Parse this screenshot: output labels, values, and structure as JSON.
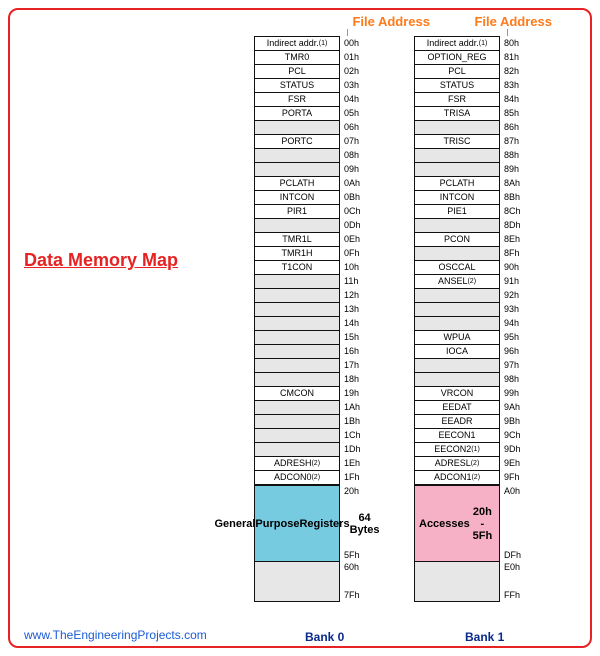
{
  "title": "Data Memory Map",
  "url": "www.TheEngineeringProjects.com",
  "headers": {
    "fileAddress": "File Address"
  },
  "bankLabels": {
    "bank0": "Bank 0",
    "bank1": "Bank 1"
  },
  "bank0": {
    "rows": [
      {
        "name": "Indirect addr.",
        "sup": "(1)",
        "addr": "00h"
      },
      {
        "name": "TMR0",
        "addr": "01h"
      },
      {
        "name": "PCL",
        "addr": "02h"
      },
      {
        "name": "STATUS",
        "addr": "03h"
      },
      {
        "name": "FSR",
        "addr": "04h"
      },
      {
        "name": "PORTA",
        "addr": "05h"
      },
      {
        "name": "",
        "reserved": true,
        "addr": "06h"
      },
      {
        "name": "PORTC",
        "addr": "07h"
      },
      {
        "name": "",
        "reserved": true,
        "addr": "08h"
      },
      {
        "name": "",
        "reserved": true,
        "addr": "09h"
      },
      {
        "name": "PCLATH",
        "addr": "0Ah"
      },
      {
        "name": "INTCON",
        "addr": "0Bh"
      },
      {
        "name": "PIR1",
        "addr": "0Ch"
      },
      {
        "name": "",
        "reserved": true,
        "addr": "0Dh"
      },
      {
        "name": "TMR1L",
        "addr": "0Eh"
      },
      {
        "name": "TMR1H",
        "addr": "0Fh"
      },
      {
        "name": "T1CON",
        "addr": "10h"
      },
      {
        "name": "",
        "reserved": true,
        "addr": "11h"
      },
      {
        "name": "",
        "reserved": true,
        "addr": "12h"
      },
      {
        "name": "",
        "reserved": true,
        "addr": "13h"
      },
      {
        "name": "",
        "reserved": true,
        "addr": "14h"
      },
      {
        "name": "",
        "reserved": true,
        "addr": "15h"
      },
      {
        "name": "",
        "reserved": true,
        "addr": "16h"
      },
      {
        "name": "",
        "reserved": true,
        "addr": "17h"
      },
      {
        "name": "",
        "reserved": true,
        "addr": "18h"
      },
      {
        "name": "CMCON",
        "addr": "19h"
      },
      {
        "name": "",
        "reserved": true,
        "addr": "1Ah"
      },
      {
        "name": "",
        "reserved": true,
        "addr": "1Bh"
      },
      {
        "name": "",
        "reserved": true,
        "addr": "1Ch"
      },
      {
        "name": "",
        "reserved": true,
        "addr": "1Dh"
      },
      {
        "name": "ADRESH",
        "sup": "(2)",
        "addr": "1Eh"
      },
      {
        "name": "ADCON0",
        "sup": "(2)",
        "addr": "1Fh"
      }
    ],
    "gpBlock": {
      "line1": "General",
      "line2": "Purpose",
      "line3": "Registers",
      "line4": "64 Bytes",
      "addrTop": "20h",
      "addrBottom": "5Fh"
    },
    "greyBlock": {
      "addrTop": "60h",
      "addrBottom": "7Fh"
    }
  },
  "bank1": {
    "rows": [
      {
        "name": "Indirect addr.",
        "sup": "(1)",
        "addr": "80h"
      },
      {
        "name": "OPTION_REG",
        "addr": "81h"
      },
      {
        "name": "PCL",
        "addr": "82h"
      },
      {
        "name": "STATUS",
        "addr": "83h"
      },
      {
        "name": "FSR",
        "addr": "84h"
      },
      {
        "name": "TRISA",
        "addr": "85h"
      },
      {
        "name": "",
        "reserved": true,
        "addr": "86h"
      },
      {
        "name": "TRISC",
        "addr": "87h"
      },
      {
        "name": "",
        "reserved": true,
        "addr": "88h"
      },
      {
        "name": "",
        "reserved": true,
        "addr": "89h"
      },
      {
        "name": "PCLATH",
        "addr": "8Ah"
      },
      {
        "name": "INTCON",
        "addr": "8Bh"
      },
      {
        "name": "PIE1",
        "addr": "8Ch"
      },
      {
        "name": "",
        "reserved": true,
        "addr": "8Dh"
      },
      {
        "name": "PCON",
        "addr": "8Eh"
      },
      {
        "name": "",
        "reserved": true,
        "addr": "8Fh"
      },
      {
        "name": "OSCCAL",
        "addr": "90h"
      },
      {
        "name": "ANSEL",
        "sup": "(2)",
        "addr": "91h"
      },
      {
        "name": "",
        "reserved": true,
        "addr": "92h"
      },
      {
        "name": "",
        "reserved": true,
        "addr": "93h"
      },
      {
        "name": "",
        "reserved": true,
        "addr": "94h"
      },
      {
        "name": "WPUA",
        "addr": "95h"
      },
      {
        "name": "IOCA",
        "addr": "96h"
      },
      {
        "name": "",
        "reserved": true,
        "addr": "97h"
      },
      {
        "name": "",
        "reserved": true,
        "addr": "98h"
      },
      {
        "name": "VRCON",
        "addr": "99h"
      },
      {
        "name": "EEDAT",
        "addr": "9Ah"
      },
      {
        "name": "EEADR",
        "addr": "9Bh"
      },
      {
        "name": "EECON1",
        "addr": "9Ch"
      },
      {
        "name": "EECON2",
        "sup": "(1)",
        "addr": "9Dh"
      },
      {
        "name": "ADRESL",
        "sup": "(2)",
        "addr": "9Eh"
      },
      {
        "name": "ADCON1",
        "sup": "(2)",
        "addr": "9Fh"
      }
    ],
    "accBlock": {
      "line1": "Accesses",
      "line2": "20h - 5Fh",
      "addrTop": "A0h",
      "addrBottom": "DFh"
    },
    "greyBlock": {
      "addrTop": "E0h",
      "addrBottom": "FFh"
    }
  }
}
